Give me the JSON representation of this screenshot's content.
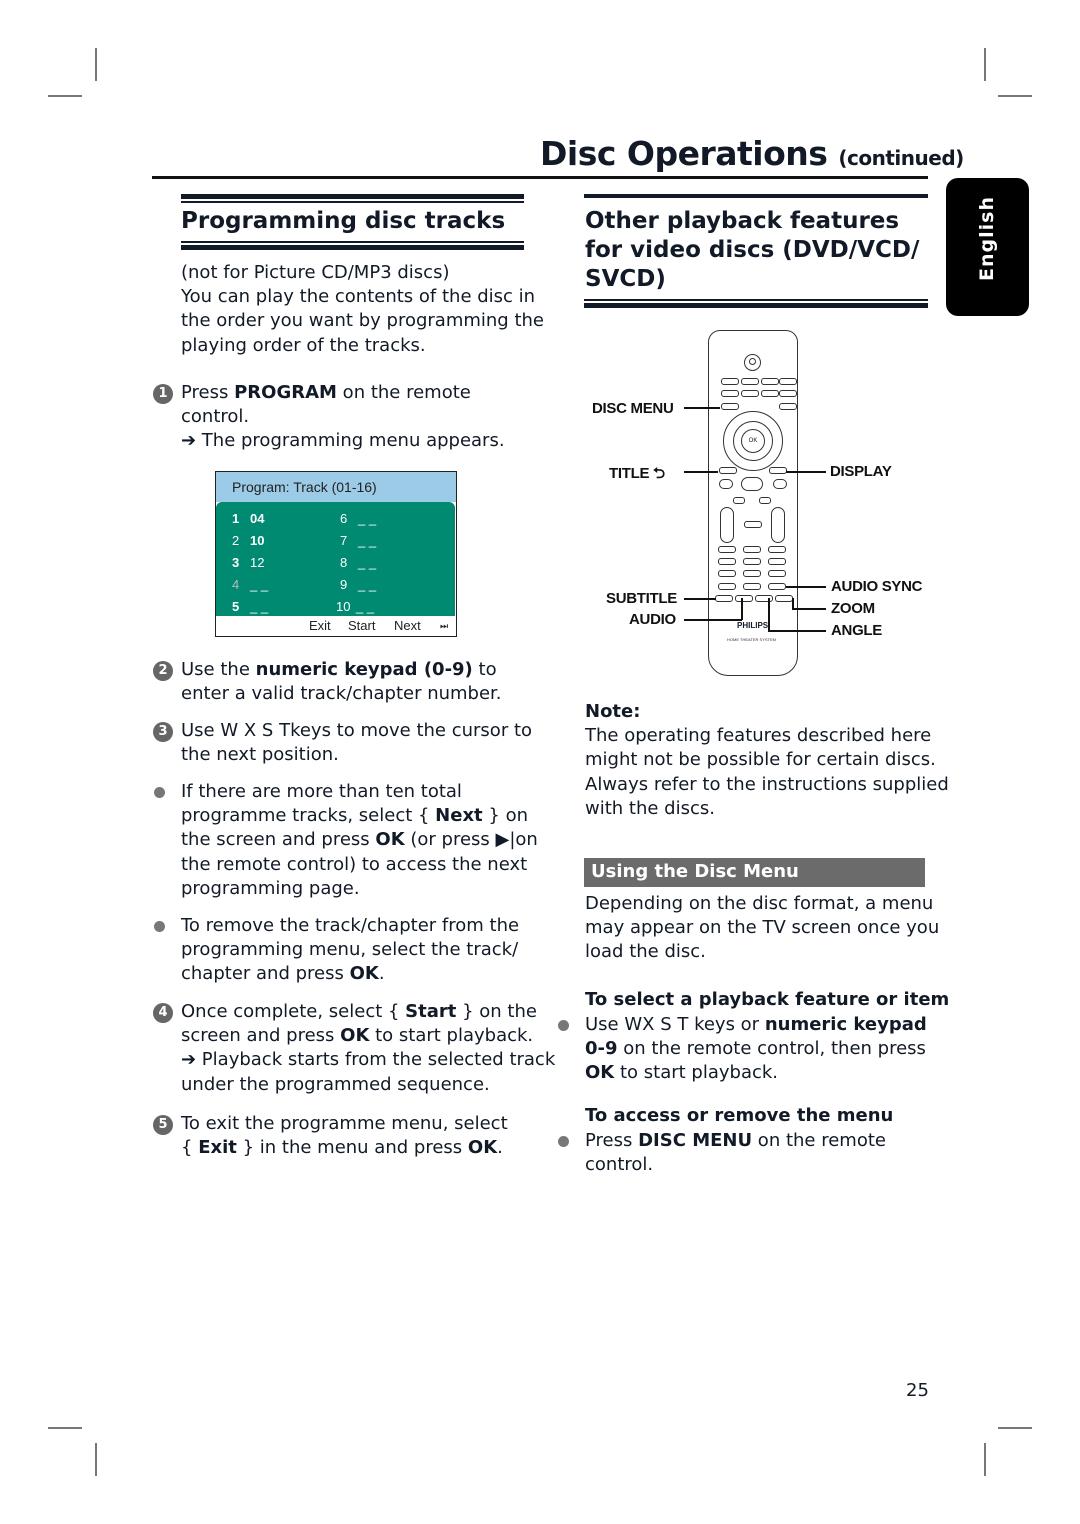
{
  "header": {
    "title": "Disc Operations",
    "title_suffix": "(continued)"
  },
  "language_tab": "English",
  "left": {
    "heading": "Programming disc tracks",
    "intro": {
      "line1": "(not for Picture CD/MP3 discs)",
      "line2": "You can play the contents of the disc in",
      "line3": "the order you want by programming the",
      "line4": "playing order of the tracks."
    },
    "step1": {
      "num": "1",
      "pre": "Press ",
      "bold": "PROGRAM",
      "post": " on the remote",
      "line2": "control.",
      "result": "➔ The programming menu appears."
    },
    "osd": {
      "title": "Program: Track (01-16)",
      "left_entries": [
        {
          "n": "1",
          "v": "04"
        },
        {
          "n": "2",
          "v": "10"
        },
        {
          "n": "3",
          "v": "12"
        },
        {
          "n": "4",
          "v": "_ _"
        },
        {
          "n": "5",
          "v": "_ _"
        }
      ],
      "right_entries": [
        {
          "n": "6",
          "v": "_ _"
        },
        {
          "n": "7",
          "v": "_ _"
        },
        {
          "n": "8",
          "v": "_ _"
        },
        {
          "n": "9",
          "v": "_ _"
        },
        {
          "n": "10",
          "v": "_ _"
        }
      ],
      "footer": {
        "exit": "Exit",
        "start": "Start",
        "next": "Next",
        "next_icon": "⏭"
      }
    },
    "step2": {
      "num": "2",
      "pre": "Use the ",
      "bold": "numeric keypad (0-9)",
      "post": " to",
      "line2": "enter a valid track/chapter number."
    },
    "step3": {
      "num": "3",
      "line1": "Use  W X S Tkeys to move the cursor to",
      "line2": "the next position."
    },
    "bullet1": {
      "line1": "If there are more than ten total",
      "line2_pre": "programme tracks, select { ",
      "line2_bold": "Next",
      "line2_post": " } on",
      "line3_pre": "the screen and press ",
      "line3_bold": "OK",
      "line3_post": " (or press ▶|on",
      "line4": "the remote control) to access the next",
      "line5": "programming page."
    },
    "bullet2": {
      "line1": "To remove the track/chapter from the",
      "line2": "programming menu, select the track/",
      "line3_pre": "chapter and press ",
      "line3_bold": "OK",
      "line3_post": "."
    },
    "step4": {
      "num": "4",
      "line1_pre": "Once complete, select { ",
      "line1_bold": "Start",
      "line1_post": " } on the",
      "line2_pre": "screen and press ",
      "line2_bold": "OK",
      "line2_post": " to start playback.",
      "line3": "➔ Playback starts from the selected track",
      "line4": "under the programmed sequence."
    },
    "step5": {
      "num": "5",
      "line1": "To exit the programme menu, select",
      "line2_pre": "{ ",
      "line2_bold": "Exit",
      "line2_mid": " } in the menu and press ",
      "line2_bold2": "OK",
      "line2_post": "."
    }
  },
  "right": {
    "heading_line1": "Other playback features",
    "heading_line2": "for video discs (DVD/VCD/",
    "heading_line3": "SVCD)",
    "remote_labels": {
      "disc_menu": "DISC MENU",
      "title": "TITLE",
      "display": "DISPLAY",
      "audio_sync": "AUDIO SYNC",
      "subtitle": "SUBTITLE",
      "zoom": "ZOOM",
      "audio": "AUDIO",
      "angle": "ANGLE"
    },
    "remote": {
      "brand": "PHILIPS",
      "model": "HOME THEATER SYSTEM",
      "ok": "OK"
    },
    "note": {
      "title": "Note:",
      "line1": "The operating features described here",
      "line2": "might not be possible for certain discs.",
      "line3": "Always refer to the instructions supplied",
      "line4": "with the discs."
    },
    "section_title": "Using the Disc Menu",
    "section_intro": {
      "line1": "Depending on the disc format, a menu",
      "line2": "may appear on the TV screen once you",
      "line3": "load the disc."
    },
    "select_feature": {
      "heading": "To select a playback feature or item",
      "line1_pre": "Use  WX S T keys or ",
      "line1_bold": "numeric keypad",
      "line2_bold": "0-9",
      "line2_post": " on the remote control, then press",
      "line3_bold": "OK",
      "line3_post": " to start playback."
    },
    "access_menu": {
      "heading": "To access or remove the menu",
      "line1_pre": "Press ",
      "line1_bold": "DISC MENU",
      "line1_post": " on the remote",
      "line2": "control."
    }
  },
  "page_number": "25"
}
